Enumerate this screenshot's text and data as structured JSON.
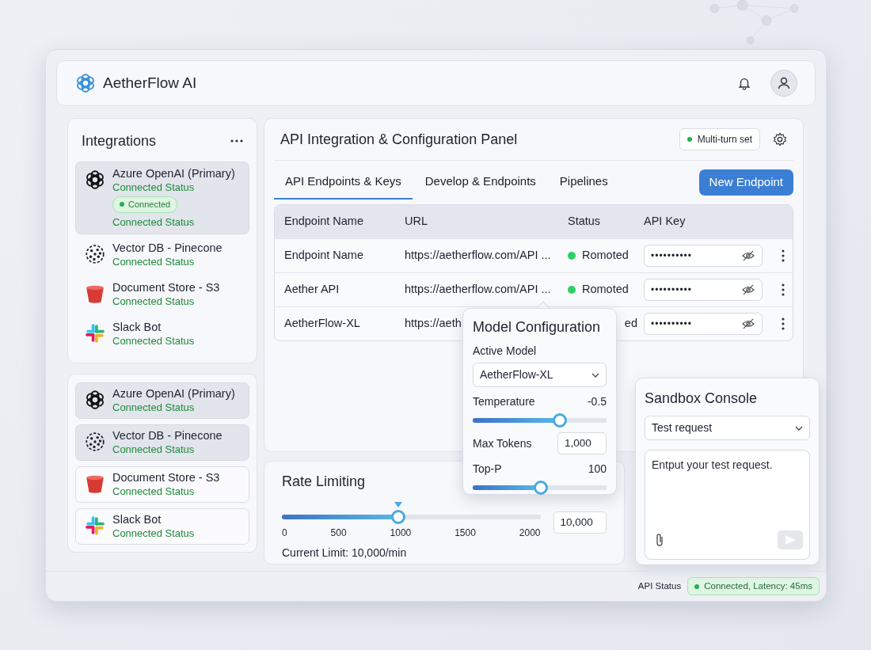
{
  "app": {
    "name": "AetherFlow AI"
  },
  "integrations": {
    "title": "Integrations",
    "items": [
      {
        "kind": "knot",
        "name": "Azure OpenAI (Primary)",
        "status": "Connected Status",
        "badge": "Connected",
        "status_after": "Connected Status",
        "selected": true
      },
      {
        "kind": "dots",
        "name": "Vector DB - Pinecone",
        "status": "Connected Status",
        "selected": false
      },
      {
        "kind": "bucket",
        "name": "Document Store - S3",
        "status": "Connected Status",
        "selected": false
      },
      {
        "kind": "pinwheel",
        "name": "Slack Bot",
        "status": "Connected Status",
        "selected": false
      }
    ]
  },
  "quick_list": [
    {
      "kind": "knot",
      "name": "Azure OpenAI (Primary)",
      "status": "Connected Status",
      "selected": true
    },
    {
      "kind": "dots",
      "name": "Vector DB - Pinecone",
      "status": "Connected Status",
      "selected": true
    },
    {
      "kind": "bucket",
      "name": "Document Store - S3",
      "status": "Connected Status",
      "selected": false
    },
    {
      "kind": "pinwheel",
      "name": "Slack Bot",
      "status": "Connected Status",
      "selected": false
    }
  ],
  "panel": {
    "title": "API Integration & Configuration Panel",
    "badge": "Multi-turn set",
    "tabs": [
      {
        "label": "API Endpoints & Keys",
        "selected": true
      },
      {
        "label": "Develop & Endpoints",
        "selected": false
      },
      {
        "label": "Pipelines",
        "selected": false
      }
    ],
    "button": "New Endpoint",
    "table": {
      "columns": [
        "Endpoint Name",
        "URL",
        "Status",
        "API Key"
      ],
      "rows": [
        {
          "name": "Endpoint Name",
          "url": "https://aetherflow.com/API ...",
          "status": "Romoted",
          "status_dot": true,
          "key": "••••••••••"
        },
        {
          "name": "Aether API",
          "url": "https://aetherflow.com/API ...",
          "status": "Romoted",
          "status_dot": true,
          "key": "••••••••••"
        },
        {
          "name": "AetherFlow-XL",
          "url": "https://aeth",
          "status": "ed",
          "status_dot": false,
          "key": "••••••••••"
        }
      ]
    }
  },
  "model_config": {
    "title": "Model Configuration",
    "model_label": "Active Model",
    "model": "AetherFlow-XL",
    "temperature": {
      "label": "Temperature",
      "reading": "-0.5",
      "level": 0.65
    },
    "max_tokens": {
      "label": "Max Tokens",
      "value": "1,000"
    },
    "top_p": {
      "label": "Top-P",
      "reading": "100",
      "level": 0.51
    }
  },
  "rate_limiting": {
    "title": "Rate Limiting",
    "level": 0.45,
    "ticks": [
      "0",
      "500",
      "1000",
      "1500",
      "2000"
    ],
    "value": "10,000",
    "caption": "Current Limit: 10,000/min"
  },
  "sandbox": {
    "title": "Sandbox Console",
    "select": "Test request",
    "placeholder": "Entput your test request."
  },
  "status_bar": {
    "label": "API Status",
    "badge": "Connected, Latency: 45ms"
  }
}
